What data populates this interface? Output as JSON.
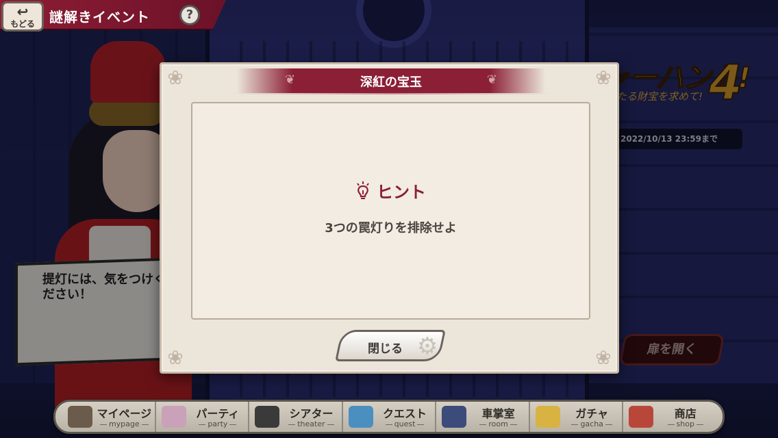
{
  "header": {
    "back_arrow": "↩",
    "back_label": "もどる",
    "title": "謎解きイベント",
    "help_label": "?"
  },
  "background": {
    "logo_main": "ジャーハント!",
    "logo_number": "4",
    "logo_sub": "たる財宝を求めて!",
    "deadline": "2022/10/13 23:59まで",
    "speech_bubble": "提灯には、気をつけください！",
    "open_door_button": "扉を開く"
  },
  "modal": {
    "title": "深紅の宝玉",
    "hint_label": "ヒント",
    "hint_text": "3つの罠灯りを排除せよ",
    "close_label": "閉じる"
  },
  "nav": [
    {
      "label": "マイページ",
      "sub": "mypage",
      "icon": "train-icon",
      "color": "#6b5b4a"
    },
    {
      "label": "パーティ",
      "sub": "party",
      "icon": "character-icon",
      "color": "#c9a1b8"
    },
    {
      "label": "シアター",
      "sub": "theater",
      "icon": "projector-icon",
      "color": "#3a3a3a"
    },
    {
      "label": "クエスト",
      "sub": "quest",
      "icon": "sword-icon",
      "color": "#4a8fbf"
    },
    {
      "label": "車掌室",
      "sub": "room",
      "icon": "pen-icon",
      "color": "#3b4b7a"
    },
    {
      "label": "ガチャ",
      "sub": "gacha",
      "icon": "ticket-icon",
      "color": "#d9b341"
    },
    {
      "label": "商店",
      "sub": "shop",
      "icon": "shop-icon",
      "color": "#b8473a"
    }
  ]
}
